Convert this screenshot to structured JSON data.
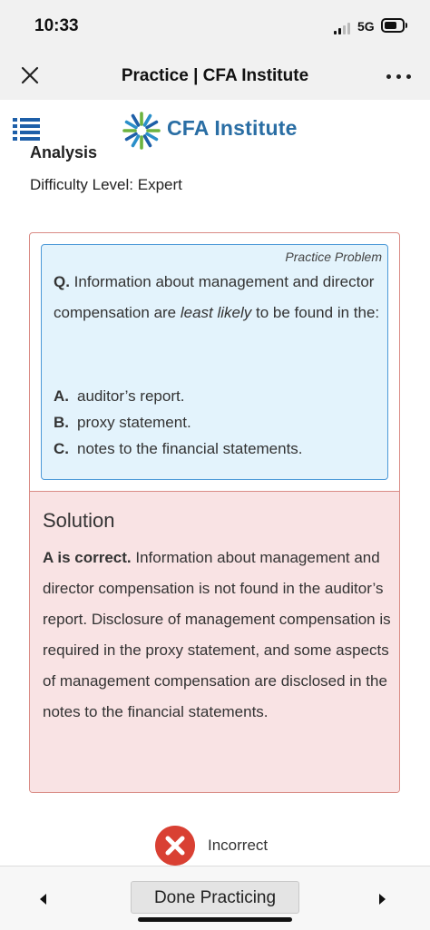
{
  "status_bar": {
    "time": "10:33",
    "network": "5G"
  },
  "nav": {
    "title": "Practice | CFA Institute"
  },
  "header": {
    "logo_text": "CFA Institute"
  },
  "topic_partial": "Analysis",
  "difficulty": "Difficulty Level: Expert",
  "problem": {
    "tag": "Practice Problem",
    "marker": "Q.",
    "text_before": " Information about management and director compensation are ",
    "text_emphasis": "least likely",
    "text_after": " to be found in the:",
    "options": [
      {
        "letter": "A.",
        "text": "auditor’s report."
      },
      {
        "letter": "B.",
        "text": "proxy statement."
      },
      {
        "letter": "C.",
        "text": "notes to the financial statements."
      }
    ]
  },
  "solution": {
    "title": "Solution",
    "verdict": "A is correct.",
    "body": " Information about management and director compensation is not found in the auditor’s report. Disclosure of management compensation is required in the proxy statement, and some aspects of management compensation are disclosed in the notes to the financial statements."
  },
  "result": {
    "label": "Incorrect",
    "icon": "x-icon"
  },
  "footer": {
    "done_label": "Done Practicing"
  },
  "colors": {
    "brand": "#2a6ea4",
    "problem_bg": "#e3f3fc",
    "problem_border": "#4d9ad8",
    "solution_bg": "#f9e3e4",
    "card_border": "#d98b85",
    "incorrect": "#d94033"
  }
}
